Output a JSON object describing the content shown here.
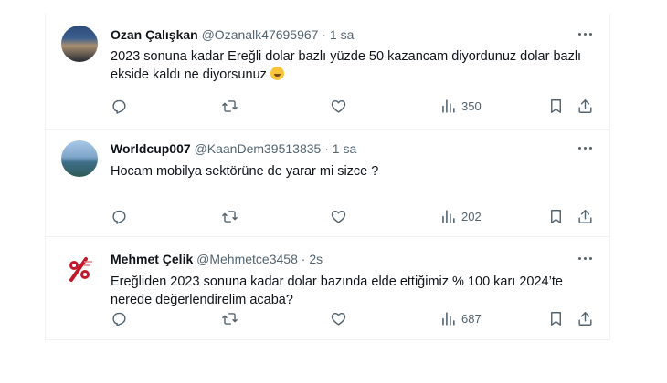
{
  "tweets": [
    {
      "name": "Ozan Çalışkan",
      "handle": "@Ozanalk47695967",
      "time": "1 sa",
      "text": "2023 sonuna kadar Ereğli dolar bazlı yüzde 50 kazancam diyordunuz dolar bazlı ekside kaldı ne diyorsunuz",
      "emoji": "sweat-smile-emoji",
      "views": "350"
    },
    {
      "name": "Worldcup007",
      "handle": "@KaanDem39513835",
      "time": "1 sa",
      "text": "Hocam mobilya sektörüne de yarar mi sizce ?",
      "views": "202"
    },
    {
      "name": "Mehmet Çelik",
      "handle": "@Mehmetce3458",
      "time": "2s",
      "text": "Ereğliden 2023 sonuna kadar dolar bazında elde ettiğimiz % 100 karı 2024’te nerede değerlendirelim acaba?",
      "views": "687"
    }
  ],
  "separator": "·",
  "colors": {
    "text": "#0f1419",
    "muted": "#536471",
    "border": "#eff3f4"
  },
  "icons": [
    "reply-icon",
    "retweet-icon",
    "like-icon",
    "views-icon",
    "bookmark-icon",
    "share-icon",
    "more-icon"
  ]
}
